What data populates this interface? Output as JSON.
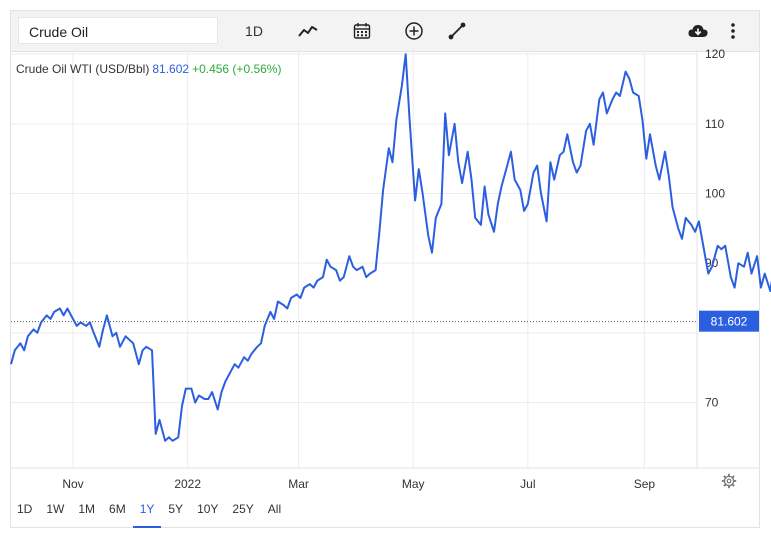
{
  "toolbar": {
    "search_value": "Crude Oil",
    "interval_label": "1D"
  },
  "chart_header": {
    "name": "Crude Oil WTI (USD/Bbl)",
    "price": "81.602",
    "change": "+0.456 (+0.56%)"
  },
  "ranges": [
    {
      "label": "1D",
      "active": false
    },
    {
      "label": "1W",
      "active": false
    },
    {
      "label": "1M",
      "active": false
    },
    {
      "label": "6M",
      "active": false
    },
    {
      "label": "1Y",
      "active": true
    },
    {
      "label": "5Y",
      "active": false
    },
    {
      "label": "10Y",
      "active": false
    },
    {
      "label": "25Y",
      "active": false
    },
    {
      "label": "All",
      "active": false
    }
  ],
  "colors": {
    "line": "#2c5fe0",
    "grid": "#ececec",
    "positive": "#2eaa3b"
  },
  "chart_data": {
    "type": "line",
    "title": "Crude Oil WTI (USD/Bbl)",
    "xlabel": "",
    "ylabel": "",
    "x_range": [
      "2021-09-29",
      "2022-09-29"
    ],
    "x_ticks": [
      {
        "label": "Nov",
        "date": "2021-11-01"
      },
      {
        "label": "2022",
        "date": "2022-01-01"
      },
      {
        "label": "Mar",
        "date": "2022-03-01"
      },
      {
        "label": "May",
        "date": "2022-05-01"
      },
      {
        "label": "Jul",
        "date": "2022-07-01"
      },
      {
        "label": "Sep",
        "date": "2022-09-01"
      }
    ],
    "y_ticks": [
      70,
      80,
      90,
      100,
      110,
      120
    ],
    "y_tick_labels_shown": [
      70,
      90,
      100,
      110,
      120
    ],
    "ylim": [
      60.6,
      120.6
    ],
    "grid": true,
    "last_value": 81.602,
    "series": [
      {
        "values": [
          [
            "2021-09-29",
            75.5
          ],
          [
            "2021-10-01",
            77.5
          ],
          [
            "2021-10-04",
            78.5
          ],
          [
            "2021-10-06",
            77.5
          ],
          [
            "2021-10-08",
            79.5
          ],
          [
            "2021-10-11",
            80.5
          ],
          [
            "2021-10-13",
            80.0
          ],
          [
            "2021-10-15",
            81.5
          ],
          [
            "2021-10-18",
            82.5
          ],
          [
            "2021-10-20",
            82.0
          ],
          [
            "2021-10-22",
            83.0
          ],
          [
            "2021-10-25",
            83.5
          ],
          [
            "2021-10-27",
            82.5
          ],
          [
            "2021-10-29",
            83.5
          ],
          [
            "2021-11-01",
            82.0
          ],
          [
            "2021-11-03",
            81.0
          ],
          [
            "2021-11-05",
            81.5
          ],
          [
            "2021-11-08",
            81.0
          ],
          [
            "2021-11-10",
            81.5
          ],
          [
            "2021-11-12",
            80.0
          ],
          [
            "2021-11-15",
            78.0
          ],
          [
            "2021-11-17",
            80.5
          ],
          [
            "2021-11-19",
            82.5
          ],
          [
            "2021-11-22",
            79.5
          ],
          [
            "2021-11-24",
            80.0
          ],
          [
            "2021-11-26",
            78.0
          ],
          [
            "2021-11-29",
            79.5
          ],
          [
            "2021-12-01",
            79.0
          ],
          [
            "2021-12-03",
            78.5
          ],
          [
            "2021-12-06",
            75.5
          ],
          [
            "2021-12-08",
            77.5
          ],
          [
            "2021-12-10",
            78.0
          ],
          [
            "2021-12-13",
            77.5
          ],
          [
            "2021-12-15",
            65.5
          ],
          [
            "2021-12-17",
            67.5
          ],
          [
            "2021-12-20",
            64.5
          ],
          [
            "2021-12-22",
            65.0
          ],
          [
            "2021-12-24",
            64.5
          ],
          [
            "2021-12-27",
            65.0
          ],
          [
            "2021-12-29",
            69.5
          ],
          [
            "2021-12-31",
            72.0
          ],
          [
            "2022-01-03",
            72.0
          ],
          [
            "2022-01-05",
            70.0
          ],
          [
            "2022-01-07",
            71.0
          ],
          [
            "2022-01-10",
            70.5
          ],
          [
            "2022-01-12",
            70.5
          ],
          [
            "2022-01-14",
            71.5
          ],
          [
            "2022-01-17",
            69.0
          ],
          [
            "2022-01-19",
            71.5
          ],
          [
            "2022-01-21",
            73.0
          ],
          [
            "2022-01-24",
            74.5
          ],
          [
            "2022-01-26",
            75.5
          ],
          [
            "2022-01-28",
            75.0
          ],
          [
            "2022-01-31",
            76.5
          ],
          [
            "2022-02-02",
            76.0
          ],
          [
            "2022-02-04",
            77.0
          ],
          [
            "2022-02-07",
            78.0
          ],
          [
            "2022-02-09",
            78.5
          ],
          [
            "2022-02-11",
            81.0
          ],
          [
            "2022-02-14",
            83.0
          ],
          [
            "2022-02-16",
            82.0
          ],
          [
            "2022-02-18",
            84.5
          ],
          [
            "2022-02-21",
            84.0
          ],
          [
            "2022-02-23",
            83.5
          ],
          [
            "2022-02-25",
            85.0
          ],
          [
            "2022-02-28",
            85.5
          ],
          [
            "2022-03-02",
            85.0
          ],
          [
            "2022-03-04",
            86.5
          ],
          [
            "2022-03-07",
            87.0
          ],
          [
            "2022-03-09",
            86.5
          ],
          [
            "2022-03-11",
            87.5
          ],
          [
            "2022-03-14",
            88.0
          ],
          [
            "2022-03-16",
            90.5
          ],
          [
            "2022-03-18",
            89.5
          ],
          [
            "2022-03-21",
            89.0
          ],
          [
            "2022-03-23",
            87.5
          ],
          [
            "2022-03-25",
            88.0
          ],
          [
            "2022-03-28",
            91.0
          ],
          [
            "2022-03-30",
            89.5
          ],
          [
            "2022-04-01",
            89.0
          ],
          [
            "2022-04-04",
            89.5
          ],
          [
            "2022-04-06",
            88.0
          ],
          [
            "2022-04-08",
            88.5
          ],
          [
            "2022-04-11",
            89.0
          ],
          [
            "2022-04-13",
            94.5
          ],
          [
            "2022-04-15",
            100.5
          ],
          [
            "2022-04-18",
            106.5
          ],
          [
            "2022-04-20",
            104.5
          ],
          [
            "2022-04-22",
            110.5
          ],
          [
            "2022-04-25",
            115.5
          ],
          [
            "2022-04-27",
            120.0
          ],
          [
            "2022-04-29",
            111.0
          ],
          [
            "2022-05-02",
            99.0
          ],
          [
            "2022-05-04",
            103.5
          ],
          [
            "2022-05-06",
            100.0
          ],
          [
            "2022-05-09",
            94.0
          ],
          [
            "2022-05-11",
            91.5
          ],
          [
            "2022-05-13",
            96.5
          ],
          [
            "2022-05-16",
            98.5
          ],
          [
            "2022-05-18",
            111.5
          ],
          [
            "2022-05-20",
            105.5
          ],
          [
            "2022-05-23",
            110.0
          ],
          [
            "2022-05-25",
            104.5
          ],
          [
            "2022-05-27",
            101.5
          ],
          [
            "2022-05-30",
            106.0
          ],
          [
            "2022-06-01",
            102.0
          ],
          [
            "2022-06-03",
            96.5
          ],
          [
            "2022-06-06",
            95.5
          ],
          [
            "2022-06-08",
            101.0
          ],
          [
            "2022-06-10",
            97.0
          ],
          [
            "2022-06-13",
            94.5
          ],
          [
            "2022-06-15",
            98.5
          ],
          [
            "2022-06-17",
            101.0
          ],
          [
            "2022-06-20",
            104.0
          ],
          [
            "2022-06-22",
            106.0
          ],
          [
            "2022-06-24",
            102.0
          ],
          [
            "2022-06-27",
            100.5
          ],
          [
            "2022-06-29",
            97.5
          ],
          [
            "2022-07-01",
            98.5
          ],
          [
            "2022-07-04",
            103.0
          ],
          [
            "2022-07-06",
            104.0
          ],
          [
            "2022-07-08",
            100.0
          ],
          [
            "2022-07-11",
            96.0
          ],
          [
            "2022-07-13",
            104.5
          ],
          [
            "2022-07-15",
            102.0
          ],
          [
            "2022-07-18",
            105.5
          ],
          [
            "2022-07-20",
            106.0
          ],
          [
            "2022-07-22",
            108.5
          ],
          [
            "2022-07-25",
            104.5
          ],
          [
            "2022-07-27",
            103.0
          ],
          [
            "2022-07-29",
            104.0
          ],
          [
            "2022-08-01",
            109.0
          ],
          [
            "2022-08-03",
            110.0
          ],
          [
            "2022-08-05",
            107.0
          ],
          [
            "2022-08-08",
            113.5
          ],
          [
            "2022-08-10",
            114.5
          ],
          [
            "2022-08-12",
            111.5
          ],
          [
            "2022-08-15",
            113.5
          ],
          [
            "2022-08-17",
            114.5
          ],
          [
            "2022-08-19",
            114.0
          ],
          [
            "2022-08-22",
            117.5
          ],
          [
            "2022-08-24",
            116.5
          ],
          [
            "2022-08-26",
            114.5
          ],
          [
            "2022-08-29",
            114.0
          ],
          [
            "2022-08-31",
            110.5
          ],
          [
            "2022-09-02",
            105.0
          ],
          [
            "2022-09-04",
            108.5
          ],
          [
            "2022-09-07",
            104.0
          ],
          [
            "2022-09-09",
            102.0
          ],
          [
            "2022-09-12",
            106.0
          ],
          [
            "2022-09-14",
            102.5
          ],
          [
            "2022-09-16",
            98.0
          ],
          [
            "2022-09-19",
            95.0
          ],
          [
            "2022-09-21",
            93.5
          ],
          [
            "2022-09-23",
            96.5
          ],
          [
            "2022-09-26",
            95.5
          ],
          [
            "2022-09-28",
            94.5
          ],
          [
            "2022-09-30",
            96.0
          ],
          [
            "2022-10-03",
            91.5
          ],
          [
            "2022-10-05",
            88.5
          ],
          [
            "2022-10-07",
            89.5
          ],
          [
            "2022-10-10",
            92.5
          ],
          [
            "2022-10-12",
            92.0
          ],
          [
            "2022-10-14",
            92.5
          ],
          [
            "2022-10-17",
            88.0
          ],
          [
            "2022-10-19",
            86.5
          ],
          [
            "2022-10-21",
            90.0
          ],
          [
            "2022-10-24",
            89.5
          ],
          [
            "2022-10-26",
            91.5
          ],
          [
            "2022-10-28",
            88.5
          ],
          [
            "2022-10-31",
            91.0
          ],
          [
            "2022-11-02",
            86.5
          ],
          [
            "2022-11-04",
            88.5
          ],
          [
            "2022-11-07",
            86.0
          ],
          [
            "2022-11-09",
            89.5
          ],
          [
            "2022-11-11",
            91.0
          ],
          [
            "2022-11-14",
            88.0
          ],
          [
            "2022-11-16",
            86.5
          ],
          [
            "2022-11-18",
            86.0
          ],
          [
            "2022-11-21",
            84.5
          ],
          [
            "2022-11-23",
            88.0
          ],
          [
            "2022-11-25",
            90.5
          ],
          [
            "2022-11-28",
            89.5
          ],
          [
            "2022-11-30",
            86.0
          ],
          [
            "2022-12-02",
            83.5
          ],
          [
            "2022-12-05",
            80.5
          ],
          [
            "2022-12-07",
            81.5
          ],
          [
            "2022-12-09",
            85.5
          ],
          [
            "2022-12-12",
            87.0
          ],
          [
            "2022-12-14",
            86.0
          ]
        ]
      }
    ]
  }
}
